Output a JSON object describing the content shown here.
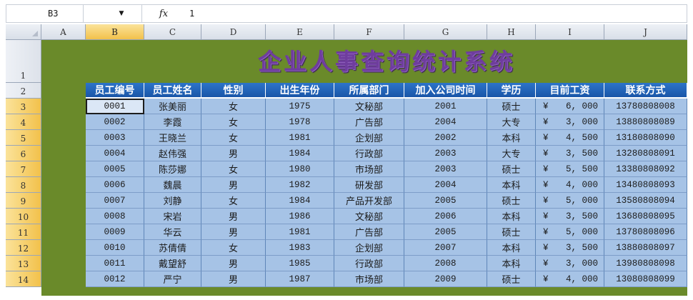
{
  "formula_bar": {
    "name_box": "B3",
    "fx_symbol": "fx",
    "value": "1"
  },
  "columns": [
    "A",
    "B",
    "C",
    "D",
    "E",
    "F",
    "G",
    "H",
    "I",
    "J"
  ],
  "selected_column": "B",
  "rows": [
    "1",
    "2",
    "3",
    "4",
    "5",
    "6",
    "7",
    "8",
    "9",
    "10",
    "11",
    "12",
    "13",
    "14"
  ],
  "title": "企业人事查询统计系统",
  "table": {
    "headers": [
      "员工编号",
      "员工姓名",
      "性别",
      "出生年份",
      "所属部门",
      "加入公司时间",
      "学历",
      "目前工资",
      "联系方式"
    ],
    "currency_symbol": "¥",
    "records": [
      [
        "0001",
        "张美丽",
        "女",
        "1975",
        "文秘部",
        "2001",
        "硕士",
        "6, 000",
        "13780808008"
      ],
      [
        "0002",
        "李霞",
        "女",
        "1978",
        "广告部",
        "2004",
        "大专",
        "3, 000",
        "13880808089"
      ],
      [
        "0003",
        "王晓兰",
        "女",
        "1981",
        "企划部",
        "2002",
        "本科",
        "4, 500",
        "13180808090"
      ],
      [
        "0004",
        "赵伟强",
        "男",
        "1984",
        "行政部",
        "2003",
        "大专",
        "3, 500",
        "13280808091"
      ],
      [
        "0005",
        "陈莎娜",
        "女",
        "1980",
        "市场部",
        "2003",
        "硕士",
        "5, 500",
        "13380808092"
      ],
      [
        "0006",
        "魏晨",
        "男",
        "1982",
        "研发部",
        "2004",
        "本科",
        "4, 000",
        "13480808093"
      ],
      [
        "0007",
        "刘静",
        "女",
        "1984",
        "产品开发部",
        "2005",
        "硕士",
        "5, 000",
        "13580808094"
      ],
      [
        "0008",
        "宋岩",
        "男",
        "1986",
        "文秘部",
        "2006",
        "本科",
        "3, 500",
        "13680808095"
      ],
      [
        "0009",
        "华云",
        "男",
        "1981",
        "广告部",
        "2005",
        "硕士",
        "5, 000",
        "13780808096"
      ],
      [
        "0010",
        "苏倩倩",
        "女",
        "1983",
        "企划部",
        "2007",
        "本科",
        "3, 500",
        "13880808097"
      ],
      [
        "0011",
        "戴望舒",
        "男",
        "1985",
        "行政部",
        "2008",
        "本科",
        "3, 000",
        "13980808098"
      ],
      [
        "0012",
        "严宁",
        "男",
        "1987",
        "市场部",
        "2009",
        "硕士",
        "4, 000",
        "13080808099"
      ]
    ]
  },
  "colors": {
    "sheet_background": "#6a8a2a",
    "title": "#6f3d9e",
    "header_fill": "#1f62b5",
    "data_fill": "#a6c3e6",
    "selected_header": "#f2c14b"
  }
}
